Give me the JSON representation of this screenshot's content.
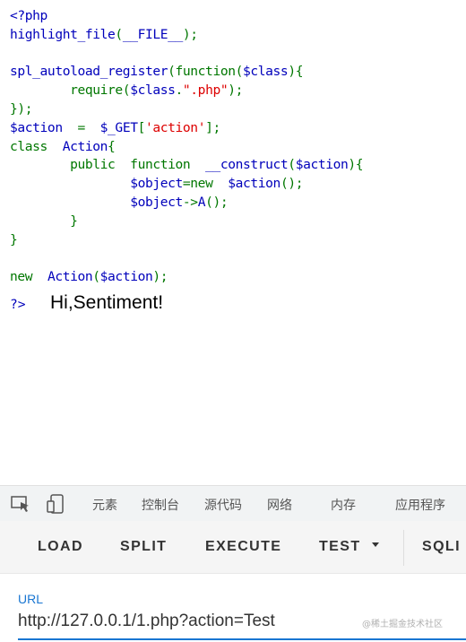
{
  "code_lines": [
    {
      "segments": [
        {
          "t": "<?php",
          "c": "d"
        }
      ]
    },
    {
      "segments": [
        {
          "t": "highlight_file",
          "c": "d"
        },
        {
          "t": "(",
          "c": "k"
        },
        {
          "t": "__FILE__",
          "c": "d"
        },
        {
          "t": ");",
          "c": "k"
        }
      ]
    },
    {
      "segments": [
        {
          "t": "",
          "c": "d"
        }
      ]
    },
    {
      "segments": [
        {
          "t": "spl_autoload_register",
          "c": "d"
        },
        {
          "t": "(function(",
          "c": "k"
        },
        {
          "t": "$class",
          "c": "d"
        },
        {
          "t": "){",
          "c": "k"
        }
      ]
    },
    {
      "segments": [
        {
          "t": "        require(",
          "c": "k"
        },
        {
          "t": "$class",
          "c": "d"
        },
        {
          "t": ".",
          "c": "k"
        },
        {
          "t": "\".php\"",
          "c": "s"
        },
        {
          "t": ");",
          "c": "k"
        }
      ]
    },
    {
      "segments": [
        {
          "t": "});",
          "c": "k"
        }
      ]
    },
    {
      "segments": [
        {
          "t": "$action  ",
          "c": "d"
        },
        {
          "t": "=  ",
          "c": "k"
        },
        {
          "t": "$_GET",
          "c": "d"
        },
        {
          "t": "[",
          "c": "k"
        },
        {
          "t": "'action'",
          "c": "s"
        },
        {
          "t": "];",
          "c": "k"
        }
      ]
    },
    {
      "segments": [
        {
          "t": "class  ",
          "c": "k"
        },
        {
          "t": "Action",
          "c": "d"
        },
        {
          "t": "{",
          "c": "k"
        }
      ]
    },
    {
      "segments": [
        {
          "t": "        public  function  ",
          "c": "k"
        },
        {
          "t": "__construct",
          "c": "d"
        },
        {
          "t": "(",
          "c": "k"
        },
        {
          "t": "$action",
          "c": "d"
        },
        {
          "t": "){",
          "c": "k"
        }
      ]
    },
    {
      "segments": [
        {
          "t": "                ",
          "c": "k"
        },
        {
          "t": "$object",
          "c": "d"
        },
        {
          "t": "=new  ",
          "c": "k"
        },
        {
          "t": "$action",
          "c": "d"
        },
        {
          "t": "();",
          "c": "k"
        }
      ]
    },
    {
      "segments": [
        {
          "t": "                ",
          "c": "k"
        },
        {
          "t": "$object",
          "c": "d"
        },
        {
          "t": "->",
          "c": "k"
        },
        {
          "t": "A",
          "c": "d"
        },
        {
          "t": "();",
          "c": "k"
        }
      ]
    },
    {
      "segments": [
        {
          "t": "        }",
          "c": "k"
        }
      ]
    },
    {
      "segments": [
        {
          "t": "}",
          "c": "k"
        }
      ]
    },
    {
      "segments": [
        {
          "t": "",
          "c": "d"
        }
      ]
    },
    {
      "segments": [
        {
          "t": "new  ",
          "c": "k"
        },
        {
          "t": "Action",
          "c": "d"
        },
        {
          "t": "(",
          "c": "k"
        },
        {
          "t": "$action",
          "c": "d"
        },
        {
          "t": ");",
          "c": "k"
        }
      ]
    }
  ],
  "php_close_tag": "?>",
  "output_text": "Hi,Sentiment!",
  "devtools": {
    "inspect_icon": "inspect-element-icon",
    "device_icon": "device-toggle-icon",
    "tabs": [
      "元素",
      "控制台",
      "源代码",
      "网络",
      "内存",
      "应用程序"
    ]
  },
  "hackbar": {
    "load": "LOAD",
    "split": "SPLIT",
    "execute": "EXECUTE",
    "test": "TEST",
    "sqli": "SQLI"
  },
  "url": {
    "label": "URL",
    "value": "http://127.0.0.1/1.php?action=Test"
  },
  "watermark": "@稀土掘金技术社区",
  "colors": {
    "php_default": "#0000bb",
    "php_keyword": "#007700",
    "php_string": "#dd0000",
    "accent": "#1976d2"
  }
}
